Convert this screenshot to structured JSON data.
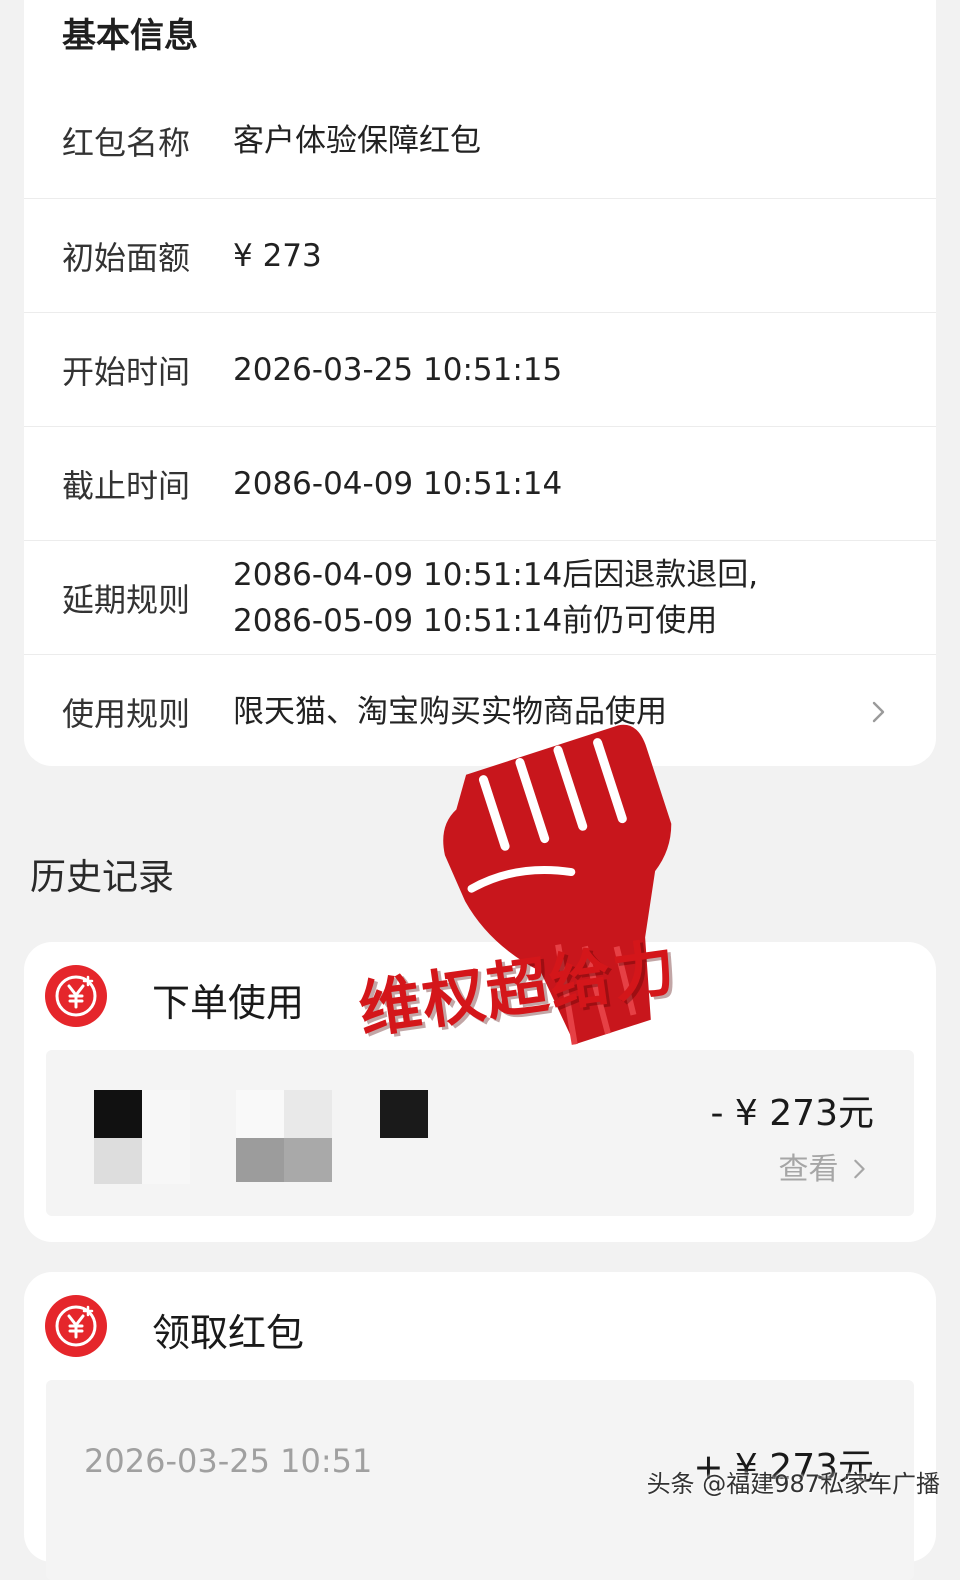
{
  "info": {
    "title": "基本信息",
    "rows": [
      {
        "label": "红包名称",
        "value": "客户体验保障红包"
      },
      {
        "label": "初始面额",
        "value": "¥ 273"
      },
      {
        "label": "开始时间",
        "value": "2026-03-25 10:51:15"
      },
      {
        "label": "截止时间",
        "value": "2086-04-09 10:51:14"
      },
      {
        "label": "延期规则",
        "value_line1": "2086-04-09 10:51:14后因退款退回,",
        "value_line2": "2086-05-09 10:51:14前仍可使用"
      },
      {
        "label": "使用规则",
        "value": "限天猫、淘宝购买实物商品使用",
        "icon": "chevron-right-icon"
      }
    ]
  },
  "history": {
    "title": "历史记录",
    "records": [
      {
        "title": "下单使用",
        "icon": "yuan-coupon-icon",
        "amount": "- ¥ 273元",
        "link": "查看"
      },
      {
        "title": "领取红包",
        "icon": "yuan-coupon-icon",
        "date": "2026-03-25 10:51",
        "amount": "+ ¥ 273元"
      }
    ]
  },
  "overlay": {
    "slogan": "维权超给力",
    "credit": "头条 @福建987私家车广播",
    "icon": "raised-fist-icon"
  },
  "colors": {
    "accent": "#e5262b",
    "background": "#f2f2f2",
    "card": "#ffffff"
  }
}
